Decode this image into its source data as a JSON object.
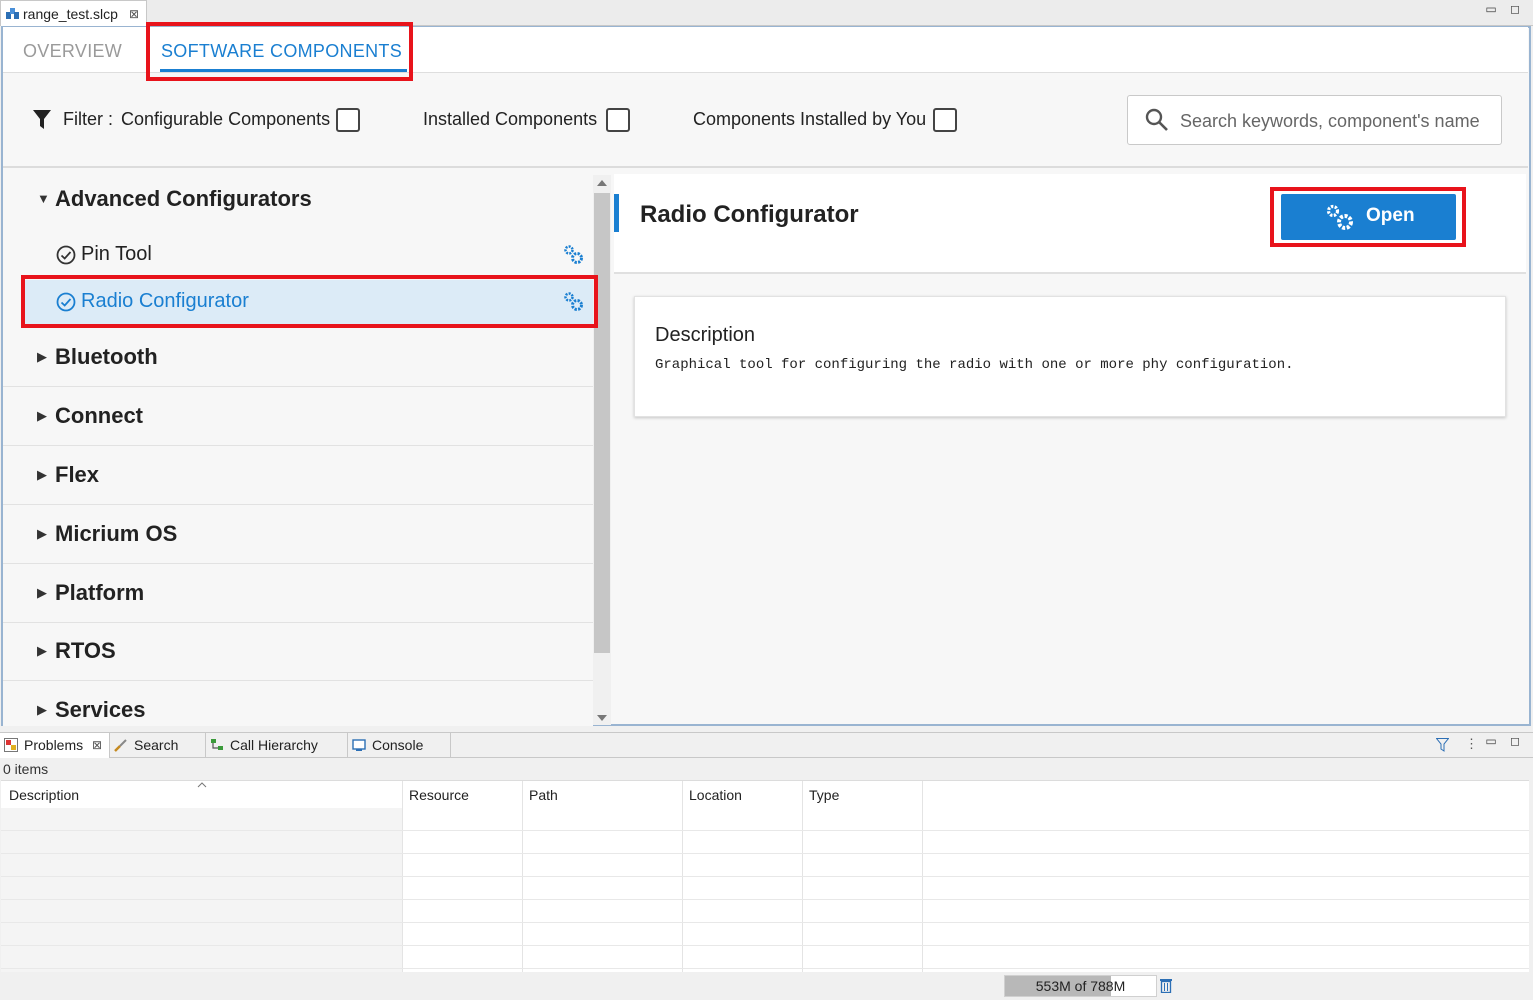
{
  "editor": {
    "tab_label": "range_test.slcp",
    "close_glyph": "⊠",
    "minimize_glyph": "▭",
    "maximize_glyph": "◻"
  },
  "tabs": {
    "overview": "OVERVIEW",
    "software_components": "SOFTWARE COMPONENTS"
  },
  "filter": {
    "label": "Filter :",
    "configurable": "Configurable Components",
    "installed": "Installed Components",
    "installed_by_you": "Components Installed by You",
    "search_placeholder": "Search keywords, component's name"
  },
  "tree": {
    "expanded_category": "Advanced Configurators",
    "leaves": [
      {
        "label": "Pin Tool"
      },
      {
        "label": "Radio Configurator"
      }
    ],
    "categories": [
      "Bluetooth",
      "Connect",
      "Flex",
      "Micrium OS",
      "Platform",
      "RTOS",
      "Services"
    ]
  },
  "detail": {
    "title": "Radio Configurator",
    "open_label": "Open",
    "description_heading": "Description",
    "description_text": "Graphical tool for configuring the radio with one or more phy configuration."
  },
  "bottom": {
    "tabs": {
      "problems": "Problems",
      "search": "Search",
      "call_hierarchy": "Call Hierarchy",
      "console": "Console"
    },
    "items_count": "0 items",
    "columns": [
      "Description",
      "Resource",
      "Path",
      "Location",
      "Type"
    ]
  },
  "status": {
    "heap": "553M of 788M",
    "heap_fraction": 0.7
  },
  "colors": {
    "accent": "#1a7fd1",
    "highlight": "#e8131b",
    "selected_row": "#dcebf7"
  }
}
